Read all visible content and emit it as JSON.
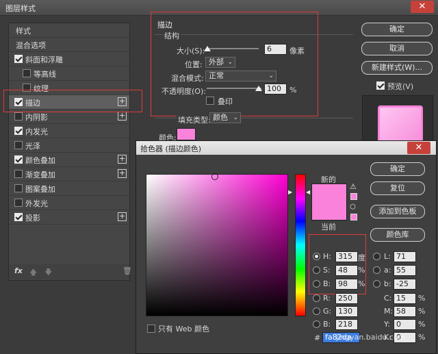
{
  "window": {
    "title": "图层样式"
  },
  "sidebar": {
    "items": [
      {
        "label": "样式",
        "checkbox": false,
        "checked": false,
        "plus": false,
        "indent": 0
      },
      {
        "label": "混合选项",
        "checkbox": false,
        "checked": false,
        "plus": false,
        "indent": 0
      },
      {
        "label": "斜面和浮雕",
        "checkbox": true,
        "checked": true,
        "plus": false,
        "indent": 0
      },
      {
        "label": "等高线",
        "checkbox": true,
        "checked": false,
        "plus": false,
        "indent": 1
      },
      {
        "label": "纹理",
        "checkbox": true,
        "checked": false,
        "plus": false,
        "indent": 1
      },
      {
        "label": "描边",
        "checkbox": true,
        "checked": true,
        "plus": true,
        "indent": 0
      },
      {
        "label": "内阴影",
        "checkbox": true,
        "checked": false,
        "plus": true,
        "indent": 0
      },
      {
        "label": "内发光",
        "checkbox": true,
        "checked": true,
        "plus": false,
        "indent": 0
      },
      {
        "label": "光泽",
        "checkbox": true,
        "checked": false,
        "plus": false,
        "indent": 0
      },
      {
        "label": "颜色叠加",
        "checkbox": true,
        "checked": true,
        "plus": true,
        "indent": 0
      },
      {
        "label": "渐变叠加",
        "checkbox": true,
        "checked": false,
        "plus": true,
        "indent": 0
      },
      {
        "label": "图案叠加",
        "checkbox": true,
        "checked": false,
        "plus": false,
        "indent": 0
      },
      {
        "label": "外发光",
        "checkbox": true,
        "checked": false,
        "plus": false,
        "indent": 0
      },
      {
        "label": "投影",
        "checkbox": true,
        "checked": true,
        "plus": true,
        "indent": 0
      }
    ],
    "footer_fx": "fx"
  },
  "stroke": {
    "section_title": "描边",
    "group_title": "结构",
    "size_label": "大小(S):",
    "size_value": "6",
    "size_unit": "像素",
    "position_label": "位置:",
    "position_value": "外部",
    "blend_label": "混合模式:",
    "blend_value": "正常",
    "opacity_label": "不透明度(O):",
    "opacity_value": "100",
    "opacity_unit": "%",
    "overprint_label": "叠印",
    "fill_type_label": "填充类型:",
    "fill_type_value": "颜色",
    "color_label": "颜色:"
  },
  "right_buttons": {
    "ok": "确定",
    "cancel": "取消",
    "new_style": "新建样式(W)...",
    "preview_label": "预览(V)",
    "preview_checked": true
  },
  "picker": {
    "title": "拾色器 (描边颜色)",
    "new_label": "新的",
    "current_label": "当前",
    "ok": "确定",
    "reset": "复位",
    "add_swatch": "添加到色板",
    "color_library": "颜色库",
    "web_only_label": "只有 Web 颜色",
    "H_label": "H:",
    "H_value": "315",
    "H_unit": "度",
    "S_label": "S:",
    "S_value": "48",
    "S_unit": "%",
    "B_label": "B:",
    "B_value": "98",
    "B_unit": "%",
    "R_label": "R:",
    "R_value": "250",
    "G_label": "G:",
    "G_value": "130",
    "Bb_label": "B:",
    "Bb_value": "218",
    "L_label": "L:",
    "L_value": "71",
    "a_label": "a:",
    "a_value": "55",
    "b_label": "b:",
    "b_value": "-25",
    "C_label": "C:",
    "C_value": "15",
    "C_unit": "%",
    "M_label": "M:",
    "M_value": "58",
    "M_unit": "%",
    "Y_label": "Y:",
    "Y_value": "0",
    "Y_unit": "%",
    "K_label": "K:",
    "K_value": "0",
    "K_unit": "%",
    "hex_label": "#",
    "hex_value": "fa82da"
  },
  "watermark": {
    "text": "jingyan.baidu.com"
  },
  "colors": {
    "selected_pink": "#fa82da",
    "highlight_red": "#e23b3b"
  }
}
